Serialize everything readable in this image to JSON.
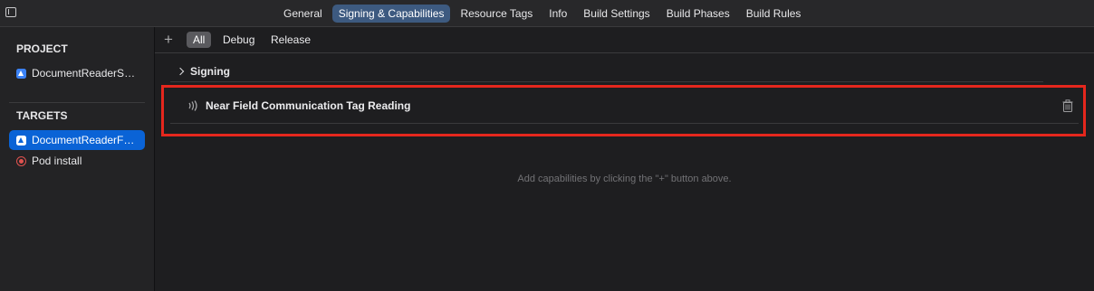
{
  "toolbar": {
    "tabs": [
      {
        "label": "General"
      },
      {
        "label": "Signing & Capabilities"
      },
      {
        "label": "Resource Tags"
      },
      {
        "label": "Info"
      },
      {
        "label": "Build Settings"
      },
      {
        "label": "Build Phases"
      },
      {
        "label": "Build Rules"
      }
    ],
    "selected_tab": "Signing & Capabilities"
  },
  "sidebar": {
    "project_header": "PROJECT",
    "project_item": {
      "label": "DocumentReaderSwi...",
      "icon": "app-icon"
    },
    "targets_header": "TARGETS",
    "targets": [
      {
        "label": "DocumentReaderFull...",
        "icon": "app-icon",
        "selected": true
      },
      {
        "label": "Pod install",
        "icon": "target-icon",
        "selected": false
      }
    ]
  },
  "config_bar": {
    "plus": "+",
    "configs": [
      {
        "label": "All",
        "selected": true
      },
      {
        "label": "Debug",
        "selected": false
      },
      {
        "label": "Release",
        "selected": false
      }
    ]
  },
  "signing": {
    "label": "Signing",
    "icon": "chevron-right-icon"
  },
  "capability": {
    "label": "Near Field Communication Tag Reading",
    "icon": "nfc-icon",
    "delete_icon": "trash-icon"
  },
  "hint": "Add capabilities by clicking the \"+\" button above.",
  "colors": {
    "background": "#1e1e20",
    "sidebar": "#232325",
    "selection": "#0a63d6",
    "tab_selected": "#3d5a80",
    "highlight_box": "#e5271d"
  }
}
